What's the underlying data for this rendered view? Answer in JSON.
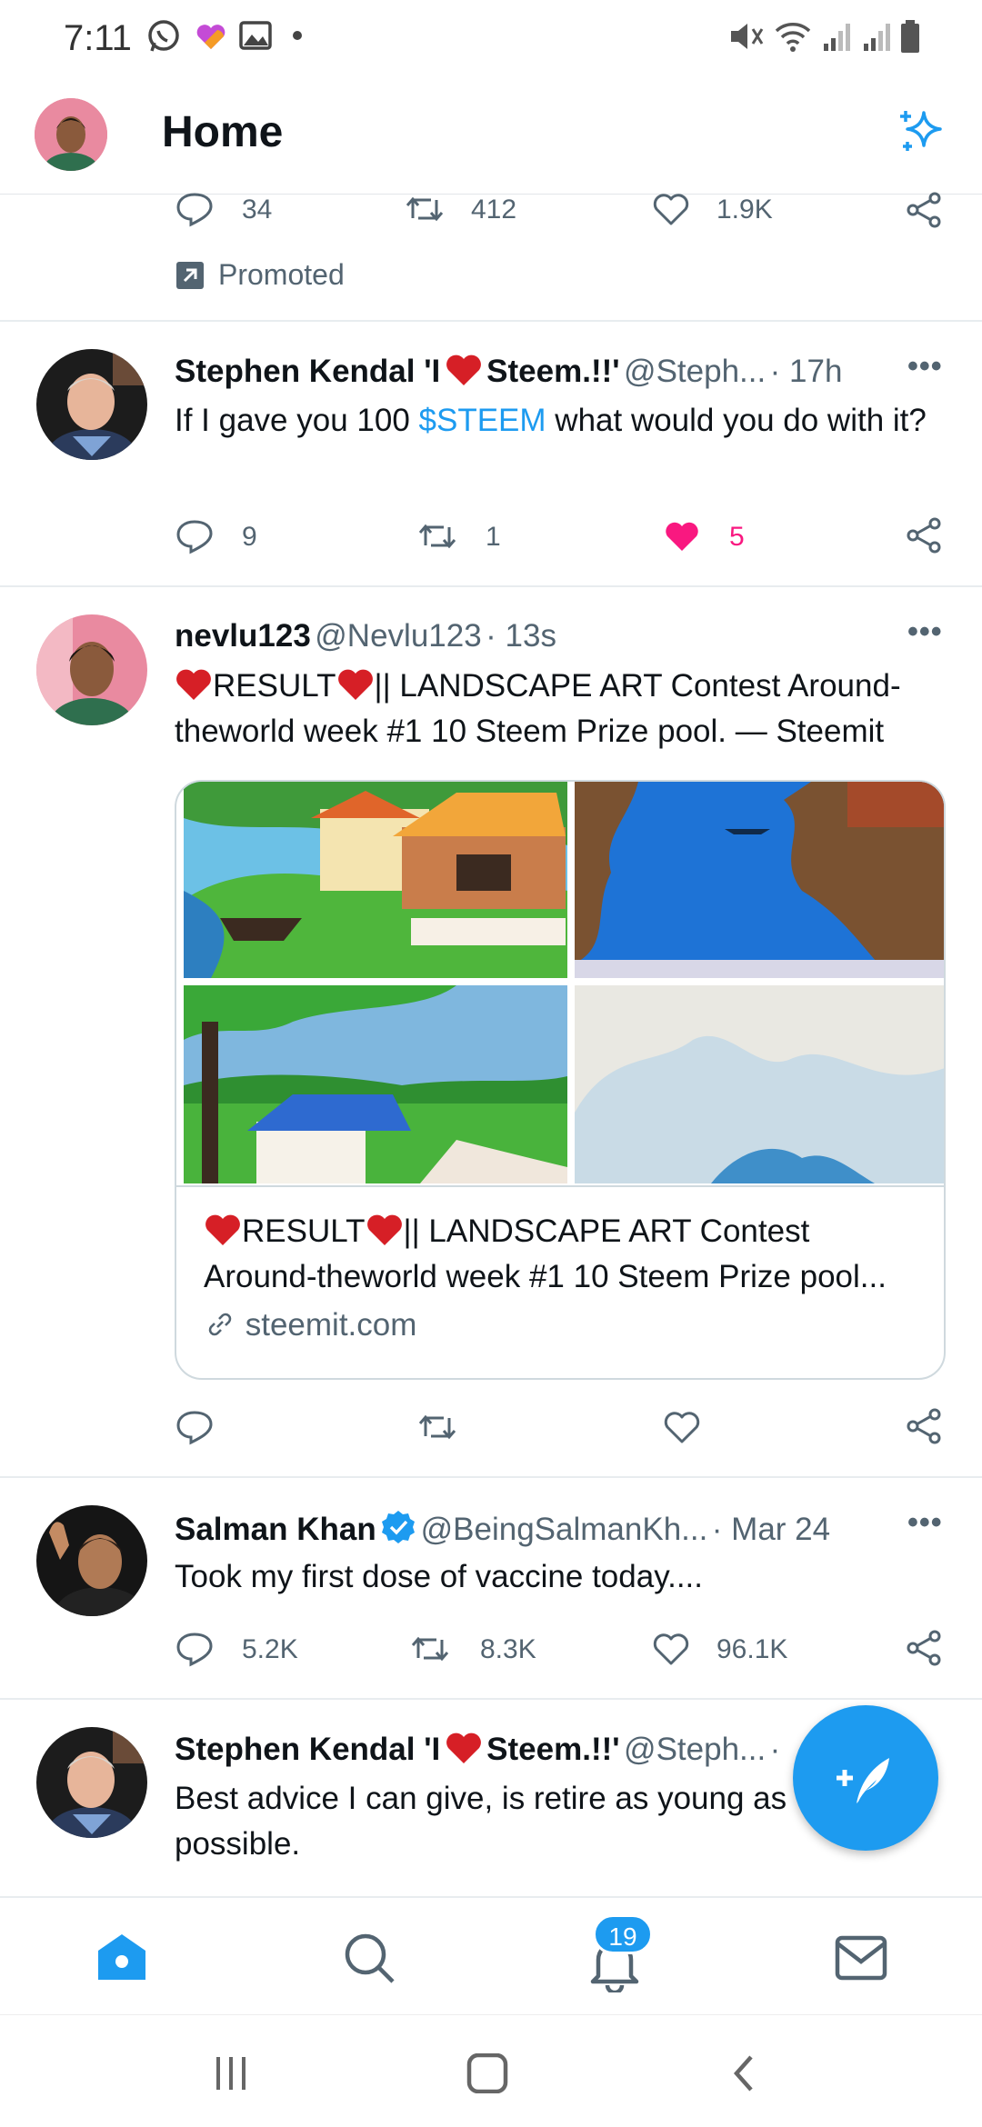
{
  "status_bar": {
    "time": "7:11"
  },
  "header": {
    "title": "Home"
  },
  "promoted_tweet": {
    "replies": "34",
    "retweets": "412",
    "likes": "1.9K",
    "promoted_label": "Promoted"
  },
  "tweets": [
    {
      "author": "Stephen Kendal 'I",
      "author_suffix": "Steem.!!'",
      "handle": "@Steph...",
      "time": "· 17h",
      "text_before": "If I gave you 100 ",
      "hashtag": "$STEEM",
      "text_after": " what would you do with it?",
      "replies": "9",
      "retweets": "1",
      "likes": "5"
    },
    {
      "author": "nevlu123",
      "handle": "@Nevlu123",
      "time": "· 13s",
      "text_part1": "RESULT",
      "text_part2": "|| LANDSCAPE ART Contest Around-theworld week #1 10 Steem Prize pool. — Steemit",
      "card_part1": "RESULT",
      "card_part2": "|| LANDSCAPE ART Contest Around-theworld week #1 10 Steem Prize pool...",
      "card_domain": "steemit.com"
    },
    {
      "author": "Salman Khan",
      "handle": "@BeingSalmanKh...",
      "time": "· Mar 24",
      "text": "Took my first dose of vaccine today....",
      "replies": "5.2K",
      "retweets": "8.3K",
      "likes": "96.1K"
    },
    {
      "author": "Stephen Kendal 'I",
      "author_suffix": "Steem.!!'",
      "handle": "@Steph...",
      "time": "·",
      "text": "Best advice I can give, is retire as young as possible."
    }
  ],
  "bottom_nav": {
    "notifications_badge": "19"
  },
  "colors": {
    "accent": "#1d9bf0",
    "like": "#f91880",
    "heart_emoji": "#d61f26"
  }
}
